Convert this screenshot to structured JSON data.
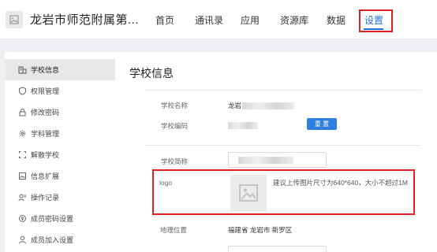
{
  "header": {
    "school_title": "龙岩市师范附属第...",
    "nav": [
      {
        "label": "首页"
      },
      {
        "label": "通讯录"
      },
      {
        "label": "应用"
      },
      {
        "label": "资源库"
      },
      {
        "label": "数据"
      },
      {
        "label": "设置"
      }
    ],
    "active_nav": "设置"
  },
  "sidebar": {
    "items": [
      {
        "label": "学校信息",
        "icon": "building-icon"
      },
      {
        "label": "权限管理",
        "icon": "shield-icon"
      },
      {
        "label": "修改密码",
        "icon": "lock-icon"
      },
      {
        "label": "学科管理",
        "icon": "gear-icon"
      },
      {
        "label": "解散学校",
        "icon": "dissolve-icon"
      },
      {
        "label": "信息扩展",
        "icon": "image-icon"
      },
      {
        "label": "操作记录",
        "icon": "record-icon"
      },
      {
        "label": "成员密码设置",
        "icon": "key-icon"
      },
      {
        "label": "成员加入设置",
        "icon": "user-icon"
      }
    ]
  },
  "main": {
    "title": "学校信息",
    "fields": {
      "school_name_label": "学校名称",
      "school_name_value": "龙岩",
      "school_code_label": "学校编码",
      "reset_button": "重 置",
      "short_name_label": "学校简称",
      "logo_label": "logo",
      "logo_hint": "建议上传图片尺寸为640*640，大小不超过1M",
      "location_label": "地理位置",
      "location_value": "福建省 龙岩市 新罗区"
    }
  },
  "colors": {
    "accent": "#1f6fd8",
    "button": "#2f7fe0",
    "highlight_box": "#e02020"
  }
}
